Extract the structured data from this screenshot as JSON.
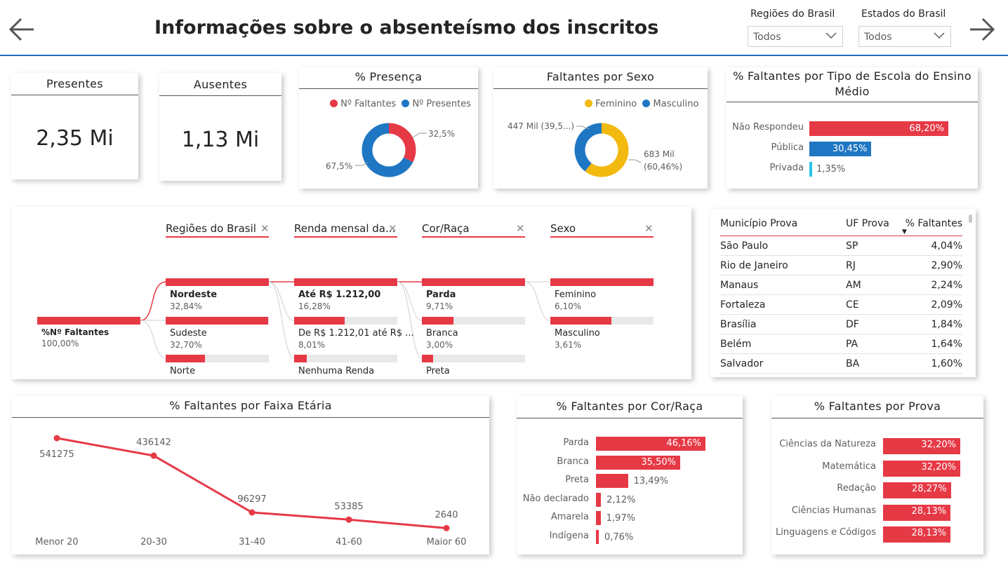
{
  "header": {
    "title": "Informações sobre o absenteísmo dos inscritos",
    "filters": [
      {
        "label": "Regiões do Brasil",
        "value": "Todos"
      },
      {
        "label": "Estados do Brasil",
        "value": "Todos"
      }
    ],
    "accent_color": "#1f6fc5"
  },
  "kpis": {
    "presentes": {
      "label": "Presentes",
      "value": "2,35 Mi"
    },
    "ausentes": {
      "label": "Ausentes",
      "value": "1,13 Mi"
    }
  },
  "presenca": {
    "title": "% Presença",
    "legend": [
      "Nº Faltantes",
      "Nº Presentes"
    ],
    "colors": [
      "#e63946",
      "#1f77c4"
    ],
    "values": [
      32.5,
      67.5
    ],
    "labels": [
      "32,5%",
      "67,5%"
    ]
  },
  "sexo": {
    "title": "Faltantes por Sexo",
    "legend": [
      "Feminino",
      "Masculino"
    ],
    "colors": [
      "#f2b90f",
      "#1f77c4"
    ],
    "values": [
      60.46,
      39.54
    ],
    "label_fem": [
      "683 Mil",
      "(60,46%)"
    ],
    "label_masc": "447 Mil (39,5...)"
  },
  "escola": {
    "title": "% Faltantes por Tipo de Escola do Ensino Médio",
    "items": [
      {
        "label": "Não Respondeu",
        "value": 68.2,
        "text": "68,20%",
        "color": "#e63946"
      },
      {
        "label": "Pública",
        "value": 30.45,
        "text": "30,45%",
        "color": "#1f77c4"
      },
      {
        "label": "Privada",
        "value": 1.35,
        "text": "1,35%",
        "color": "#27c3ea"
      }
    ]
  },
  "decomp": {
    "root": {
      "name": "%Nº Faltantes",
      "pct": "100,00%"
    },
    "levels": [
      {
        "header": "Regiões do Brasil",
        "nodes": [
          {
            "name": "Nordeste",
            "pct": "32,84%",
            "value": 32.84,
            "bold": true
          },
          {
            "name": "Sudeste",
            "pct": "32,70%",
            "value": 32.7
          },
          {
            "name": "Norte",
            "pct": "",
            "value": 12.5
          }
        ]
      },
      {
        "header": "Renda mensal da...",
        "nodes": [
          {
            "name": "Até R$ 1.212,00",
            "pct": "16,28%",
            "value": 16.28,
            "bold": true
          },
          {
            "name": "De R$ 1.212,01 até R$ ...",
            "pct": "8,01%",
            "value": 8.01
          },
          {
            "name": "Nenhuma Renda",
            "pct": "",
            "value": 2.0
          }
        ]
      },
      {
        "header": "Cor/Raça",
        "nodes": [
          {
            "name": "Parda",
            "pct": "9,71%",
            "value": 9.71,
            "bold": true
          },
          {
            "name": "Branca",
            "pct": "3,00%",
            "value": 3.0
          },
          {
            "name": "Preta",
            "pct": "",
            "value": 1.05
          }
        ]
      },
      {
        "header": "Sexo",
        "nodes": [
          {
            "name": "Feminino",
            "pct": "6,10%",
            "value": 6.1
          },
          {
            "name": "Masculino",
            "pct": "3,61%",
            "value": 3.61
          }
        ]
      }
    ]
  },
  "municipios": {
    "headers": [
      "Município Prova",
      "UF Prova",
      "% Faltantes"
    ],
    "rows": [
      [
        "São Paulo",
        "SP",
        "4,04%"
      ],
      [
        "Rio de Janeiro",
        "RJ",
        "2,90%"
      ],
      [
        "Manaus",
        "AM",
        "2,24%"
      ],
      [
        "Fortaleza",
        "CE",
        "2,09%"
      ],
      [
        "Brasília",
        "DF",
        "1,84%"
      ],
      [
        "Belém",
        "PA",
        "1,64%"
      ],
      [
        "Salvador",
        "BA",
        "1,60%"
      ]
    ]
  },
  "chart_data": [
    {
      "type": "line",
      "title": "% Faltantes por Faixa Etária",
      "categories": [
        "Menor 20",
        "20-30",
        "31-40",
        "41-60",
        "Maior 60"
      ],
      "values": [
        541275,
        436142,
        96297,
        53385,
        2640
      ],
      "color": "#e63946"
    },
    {
      "type": "bar",
      "title": "% Faltantes por Cor/Raça",
      "categories": [
        "Parda",
        "Branca",
        "Preta",
        "Não declarado",
        "Amarela",
        "Indígena"
      ],
      "values": [
        46.16,
        35.5,
        13.49,
        2.12,
        1.97,
        0.76
      ],
      "labels": [
        "46,16%",
        "35,50%",
        "13,49%",
        "2,12%",
        "1,97%",
        "0,76%"
      ]
    },
    {
      "type": "bar",
      "title": "% Faltantes por Prova",
      "categories": [
        "Ciências da Natureza",
        "Matemática",
        "Redação",
        "Ciências Humanas",
        "Linguagens e Códigos"
      ],
      "values": [
        32.2,
        32.2,
        28.27,
        28.13,
        28.13
      ],
      "labels": [
        "32,20%",
        "32,20%",
        "28,27%",
        "28,13%",
        "28,13%"
      ]
    }
  ]
}
